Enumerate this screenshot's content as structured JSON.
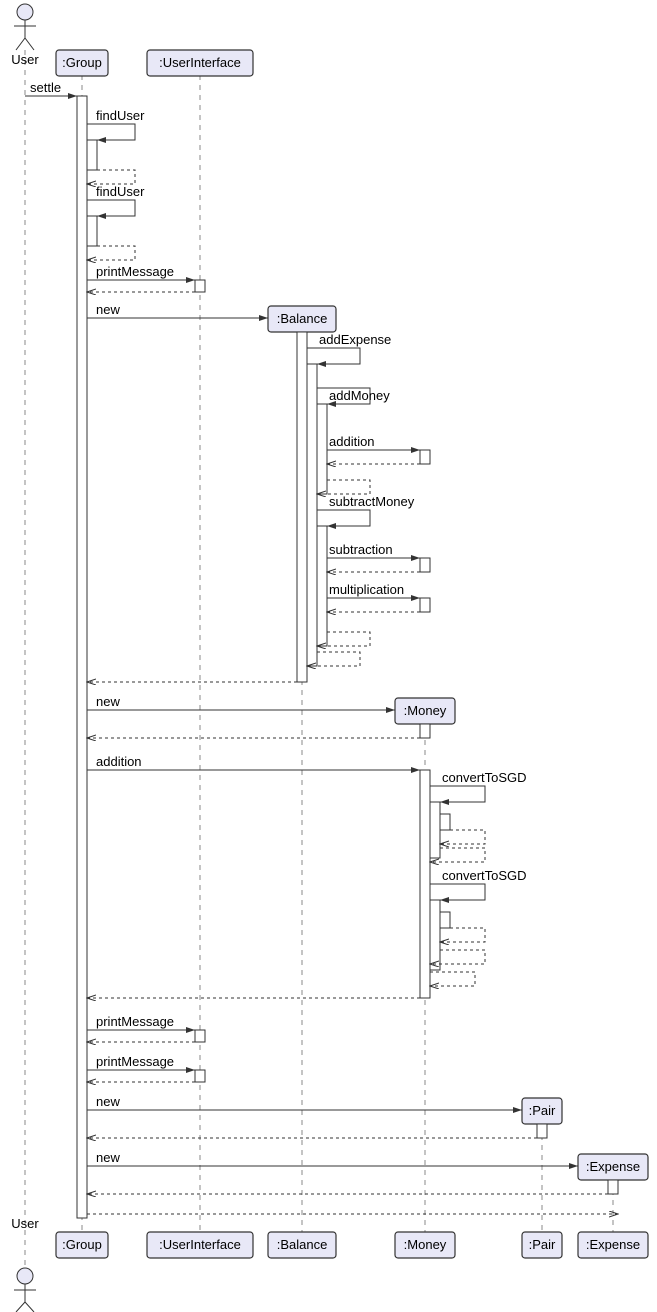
{
  "actor": {
    "name": "User"
  },
  "participants": {
    "group": ":Group",
    "ui": ":UserInterface",
    "balance": ":Balance",
    "money": ":Money",
    "pair": ":Pair",
    "expense": ":Expense"
  },
  "messages": {
    "settle": "settle",
    "findUser": "findUser",
    "printMessage": "printMessage",
    "new": "new",
    "addExpense": "addExpense",
    "addMoney": "addMoney",
    "addition": "addition",
    "subtractMoney": "subtractMoney",
    "subtraction": "subtraction",
    "multiplication": "multiplication",
    "convertToSGD": "convertToSGD"
  },
  "chart_data": {
    "type": "sequence_diagram",
    "participants": [
      "User",
      ":Group",
      ":UserInterface",
      ":Balance",
      ":Money",
      ":Pair",
      ":Expense"
    ],
    "participant_kinds": {
      "User": "actor",
      ":Group": "object",
      ":UserInterface": "object",
      ":Balance": "object_created",
      ":Money": "object_created",
      ":Pair": "object_created",
      ":Expense": "object_created"
    },
    "messages": [
      {
        "from": "User",
        "to": ":Group",
        "label": "settle",
        "type": "sync"
      },
      {
        "from": ":Group",
        "to": ":Group",
        "label": "findUser",
        "type": "self"
      },
      {
        "from": ":Group",
        "to": ":Group",
        "label": "",
        "type": "self_return"
      },
      {
        "from": ":Group",
        "to": ":Group",
        "label": "findUser",
        "type": "self"
      },
      {
        "from": ":Group",
        "to": ":Group",
        "label": "",
        "type": "self_return"
      },
      {
        "from": ":Group",
        "to": ":UserInterface",
        "label": "printMessage",
        "type": "sync"
      },
      {
        "from": ":UserInterface",
        "to": ":Group",
        "label": "",
        "type": "return"
      },
      {
        "from": ":Group",
        "to": ":Balance",
        "label": "new",
        "type": "create"
      },
      {
        "from": ":Balance",
        "to": ":Balance",
        "label": "addExpense",
        "type": "self"
      },
      {
        "from": ":Balance",
        "to": ":Balance",
        "label": "addMoney",
        "type": "self"
      },
      {
        "from": ":Balance",
        "to": ":Money",
        "label": "addition",
        "type": "sync"
      },
      {
        "from": ":Money",
        "to": ":Balance",
        "label": "",
        "type": "return"
      },
      {
        "from": ":Balance",
        "to": ":Balance",
        "label": "",
        "type": "self_return"
      },
      {
        "from": ":Balance",
        "to": ":Balance",
        "label": "subtractMoney",
        "type": "self"
      },
      {
        "from": ":Balance",
        "to": ":Money",
        "label": "subtraction",
        "type": "sync"
      },
      {
        "from": ":Money",
        "to": ":Balance",
        "label": "",
        "type": "return"
      },
      {
        "from": ":Balance",
        "to": ":Money",
        "label": "multiplication",
        "type": "sync"
      },
      {
        "from": ":Money",
        "to": ":Balance",
        "label": "",
        "type": "return"
      },
      {
        "from": ":Balance",
        "to": ":Balance",
        "label": "",
        "type": "self_return"
      },
      {
        "from": ":Balance",
        "to": ":Balance",
        "label": "",
        "type": "self_return"
      },
      {
        "from": ":Balance",
        "to": ":Group",
        "label": "",
        "type": "return"
      },
      {
        "from": ":Group",
        "to": ":Money",
        "label": "new",
        "type": "create"
      },
      {
        "from": ":Money",
        "to": ":Group",
        "label": "",
        "type": "return"
      },
      {
        "from": ":Group",
        "to": ":Money",
        "label": "addition",
        "type": "sync"
      },
      {
        "from": ":Money",
        "to": ":Money",
        "label": "convertToSGD",
        "type": "self"
      },
      {
        "from": ":Money",
        "to": ":Money",
        "label": "",
        "type": "self_return"
      },
      {
        "from": ":Money",
        "to": ":Money",
        "label": "",
        "type": "self_return"
      },
      {
        "from": ":Money",
        "to": ":Money",
        "label": "convertToSGD",
        "type": "self"
      },
      {
        "from": ":Money",
        "to": ":Money",
        "label": "",
        "type": "self_return"
      },
      {
        "from": ":Money",
        "to": ":Money",
        "label": "",
        "type": "self_return"
      },
      {
        "from": ":Money",
        "to": ":Money",
        "label": "",
        "type": "self_return"
      },
      {
        "from": ":Money",
        "to": ":Group",
        "label": "",
        "type": "return"
      },
      {
        "from": ":Group",
        "to": ":UserInterface",
        "label": "printMessage",
        "type": "sync"
      },
      {
        "from": ":UserInterface",
        "to": ":Group",
        "label": "",
        "type": "return"
      },
      {
        "from": ":Group",
        "to": ":UserInterface",
        "label": "printMessage",
        "type": "sync"
      },
      {
        "from": ":UserInterface",
        "to": ":Group",
        "label": "",
        "type": "return"
      },
      {
        "from": ":Group",
        "to": ":Pair",
        "label": "new",
        "type": "create"
      },
      {
        "from": ":Pair",
        "to": ":Group",
        "label": "",
        "type": "return"
      },
      {
        "from": ":Group",
        "to": ":Expense",
        "label": "new",
        "type": "create"
      },
      {
        "from": ":Expense",
        "to": ":Group",
        "label": "",
        "type": "return"
      },
      {
        "from": ":Group",
        "to": ":Expense",
        "label": "",
        "type": "return"
      }
    ]
  }
}
